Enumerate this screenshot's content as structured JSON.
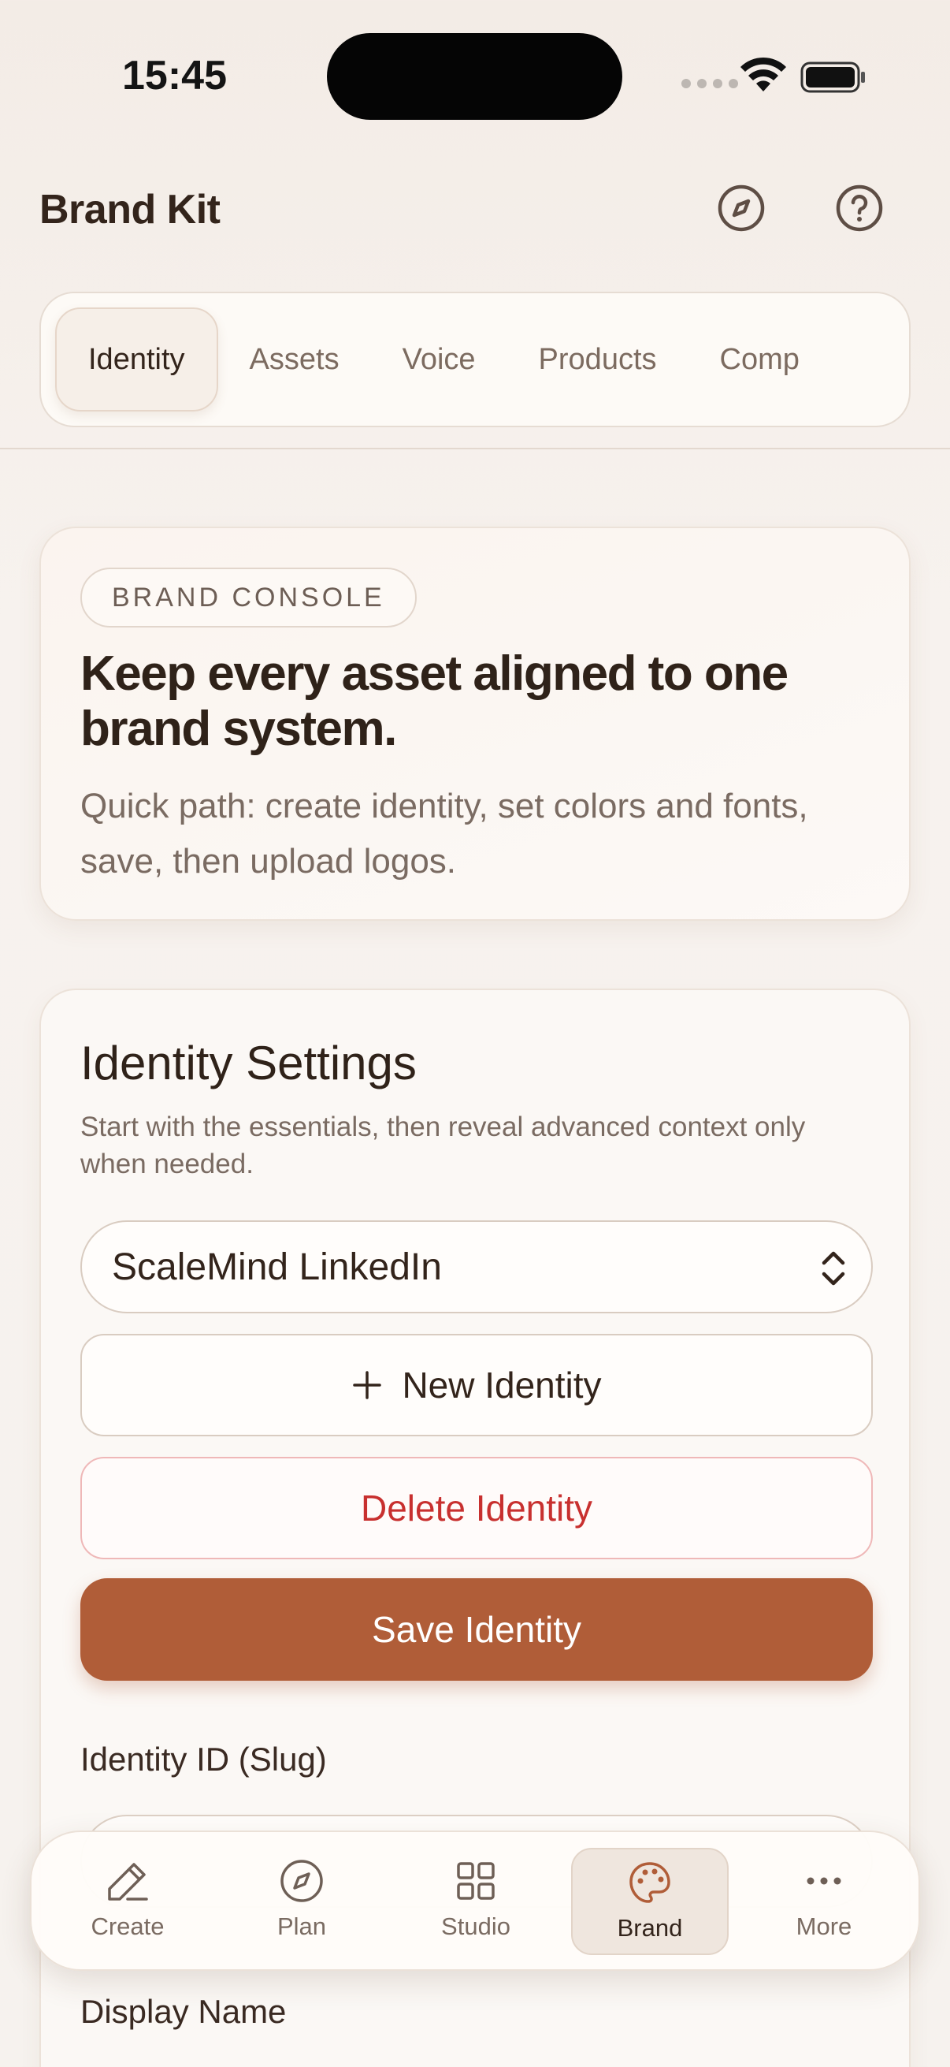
{
  "status_bar": {
    "time": "15:45"
  },
  "header": {
    "title": "Brand Kit",
    "icons": [
      "compass-icon",
      "help-icon"
    ]
  },
  "tabs": [
    {
      "label": "Identity",
      "active": true
    },
    {
      "label": "Assets",
      "active": false
    },
    {
      "label": "Voice",
      "active": false
    },
    {
      "label": "Products",
      "active": false
    },
    {
      "label": "Comp",
      "active": false
    }
  ],
  "hero": {
    "badge": "BRAND CONSOLE",
    "headline": "Keep every asset aligned to one brand system.",
    "subtitle": "Quick path: create identity, set colors and fonts, save, then upload logos."
  },
  "identity_settings": {
    "title": "Identity Settings",
    "subtitle": "Start with the essentials, then reveal advanced context only when needed.",
    "selected_identity": "ScaleMind LinkedIn",
    "new_button": "New Identity",
    "delete_button": "Delete Identity",
    "save_button": "Save Identity",
    "slug_label": "Identity ID (Slug)",
    "display_name_label": "Display Name"
  },
  "bottom_nav": [
    {
      "label": "Create",
      "icon": "pencil-icon",
      "active": false
    },
    {
      "label": "Plan",
      "icon": "compass-icon",
      "active": false
    },
    {
      "label": "Studio",
      "icon": "grid-icon",
      "active": false
    },
    {
      "label": "Brand",
      "icon": "palette-icon",
      "active": true
    },
    {
      "label": "More",
      "icon": "more-icon",
      "active": false
    }
  ],
  "colors": {
    "accent": "#b05d38",
    "danger": "#c8302f",
    "text": "#33241b",
    "muted": "#7a6b62"
  }
}
